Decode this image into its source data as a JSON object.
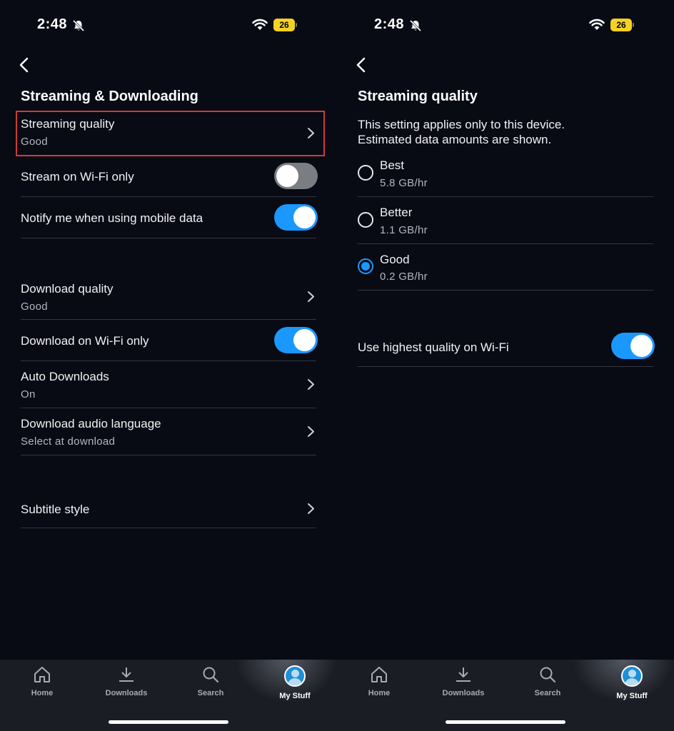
{
  "status": {
    "time": "2:48",
    "battery": "26"
  },
  "left": {
    "title": "Streaming & Downloading",
    "rows": [
      {
        "label": "Streaming quality",
        "sub": "Good"
      },
      {
        "label": "Stream on Wi-Fi only",
        "toggle": "off"
      },
      {
        "label": "Notify me when using mobile data",
        "toggle": "on"
      },
      {
        "label": "Download quality",
        "sub": "Good"
      },
      {
        "label": "Download on Wi-Fi only",
        "toggle": "on"
      },
      {
        "label": "Auto Downloads",
        "sub": "On"
      },
      {
        "label": "Download audio language",
        "sub": "Select at download"
      },
      {
        "label": "Subtitle style"
      }
    ]
  },
  "right": {
    "title": "Streaming quality",
    "description_line1": "This setting applies only to this device.",
    "description_line2": "Estimated data amounts are shown.",
    "options": [
      {
        "label": "Best",
        "sub": "5.8 GB/hr",
        "selected": false
      },
      {
        "label": "Better",
        "sub": "1.1 GB/hr",
        "selected": false
      },
      {
        "label": "Good",
        "sub": "0.2 GB/hr",
        "selected": true
      }
    ],
    "wifi_toggle_label": "Use highest quality on Wi-Fi",
    "wifi_toggle": "on"
  },
  "nav": {
    "items": [
      {
        "label": "Home",
        "icon": "home-icon"
      },
      {
        "label": "Downloads",
        "icon": "download-icon"
      },
      {
        "label": "Search",
        "icon": "search-icon"
      },
      {
        "label": "My Stuff",
        "icon": "avatar-icon",
        "active": true
      }
    ]
  },
  "colors": {
    "accent": "#1a98ff",
    "highlight": "#d23a3a",
    "battery": "#f4d223"
  }
}
